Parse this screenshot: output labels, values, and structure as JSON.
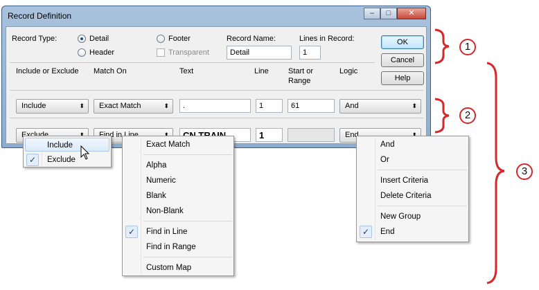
{
  "window": {
    "title": "Record Definition",
    "min_label": "–",
    "max_label": "□",
    "close_label": "✕"
  },
  "record_type": {
    "label": "Record Type:",
    "detail": "Detail",
    "header": "Header",
    "footer": "Footer",
    "transparent": "Transparent",
    "selected": "Detail"
  },
  "record_name": {
    "label": "Record Name:",
    "value": "Detail"
  },
  "lines_in_record": {
    "label": "Lines in Record:",
    "value": "1"
  },
  "buttons": {
    "ok": "OK",
    "cancel": "Cancel",
    "help": "Help"
  },
  "columns": {
    "include": "Include or Exclude",
    "match": "Match On",
    "text": "Text",
    "line": "Line",
    "start": "Start or",
    "range": "Range",
    "logic": "Logic"
  },
  "rows": [
    {
      "include": "Include",
      "match": "Exact Match",
      "text": ".",
      "line": "1",
      "start": "61",
      "logic": "And"
    },
    {
      "include": "Exclude",
      "match": "Find in Line",
      "text": "CN TRAIN",
      "line": "1",
      "start": "",
      "logic": "End"
    }
  ],
  "include_menu": {
    "items": [
      "Include",
      "Exclude"
    ],
    "checked": "Exclude",
    "hovered": "Include"
  },
  "match_menu": {
    "items": [
      "Exact Match",
      "Alpha",
      "Numeric",
      "Blank",
      "Non-Blank",
      "Find in Line",
      "Find in Range",
      "Custom Map"
    ],
    "checked": "Find in Line"
  },
  "logic_menu": {
    "items": [
      "And",
      "Or",
      "Insert Criteria",
      "Delete Criteria",
      "New Group",
      "End"
    ],
    "checked": "End"
  },
  "callouts": [
    "1",
    "2",
    "3"
  ],
  "accent_color": "#d8262a",
  "icons": {
    "check": "✓",
    "arrow": "⬍"
  }
}
